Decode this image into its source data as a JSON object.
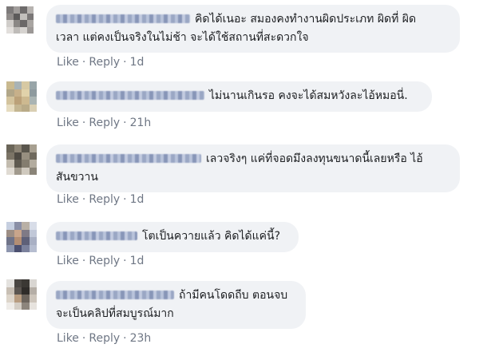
{
  "comments": [
    {
      "text_line1": "คิดได้เนอะ สมองคงทำงานผิดประเภท ผิดที่ ผิด",
      "text_line2": "เวลา แต่คงเป็นจริงในไม่ช้า จะได้ใช้สถานที่สะดวกใจ",
      "like": "Like",
      "reply": "Reply",
      "time": "1d"
    },
    {
      "text_line1": "ไม่นานเกินรอ คงจะได้สมหวังละไอ้หมอนี่.",
      "text_line2": "",
      "like": "Like",
      "reply": "Reply",
      "time": "21h"
    },
    {
      "text_line1": "เลวจริงๆ แค่ที่จอดมึงลงทุนขนาดนี้เลยหรือ ไอ้",
      "text_line2": "สันขวาน",
      "like": "Like",
      "reply": "Reply",
      "time": "1d"
    },
    {
      "text_line1": "โตเป็นควายแล้ว คิดได้แค่นี้?",
      "text_line2": "",
      "like": "Like",
      "reply": "Reply",
      "time": "1d"
    },
    {
      "text_line1": "ถ้ามีคนโดดถีบ ตอนจบ",
      "text_line2": "จะเป็นคลิปที่สมบูรณ์มาก",
      "like": "Like",
      "reply": "Reply",
      "time": "23h"
    }
  ],
  "separator": "·"
}
